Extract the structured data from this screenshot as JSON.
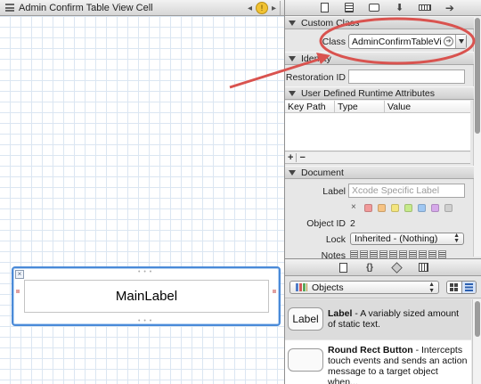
{
  "canvas": {
    "jumpbar_title": "Admin Confirm Table View Cell",
    "cell_label": "MainLabel"
  },
  "inspector": {
    "custom_class": {
      "header": "Custom Class",
      "class_label": "Class",
      "class_value": "AdminConfirmTableVi"
    },
    "identity": {
      "header": "Identity",
      "restoration_id_label": "Restoration ID",
      "restoration_id_value": ""
    },
    "runtime_attributes": {
      "header": "User Defined Runtime Attributes",
      "columns": [
        "Key Path",
        "Type",
        "Value"
      ],
      "add_symbol": "+",
      "remove_symbol": "−"
    },
    "document": {
      "header": "Document",
      "label_label": "Label",
      "label_placeholder": "Xcode Specific Label",
      "color_clear_symbol": "×",
      "label_colors": [
        "#f19a9a",
        "#f6c383",
        "#f3e57e",
        "#c6ea8a",
        "#9fc7f2",
        "#d6a9ea",
        "#cfcfcf"
      ],
      "object_id_label": "Object ID",
      "object_id_value": "2",
      "lock_label": "Lock",
      "lock_value": "Inherited - (Nothing)",
      "notes_label": "Notes"
    }
  },
  "library": {
    "filter_value": "Objects",
    "items": [
      {
        "thumb_text": "Label",
        "name": "Label",
        "description": " - A variably sized amount of static text."
      },
      {
        "thumb_text": "",
        "name": "Round Rect Button",
        "description": " - Intercepts touch events and sends an action message to a target object when..."
      }
    ]
  },
  "annotation": {
    "color": "#d9534f"
  }
}
